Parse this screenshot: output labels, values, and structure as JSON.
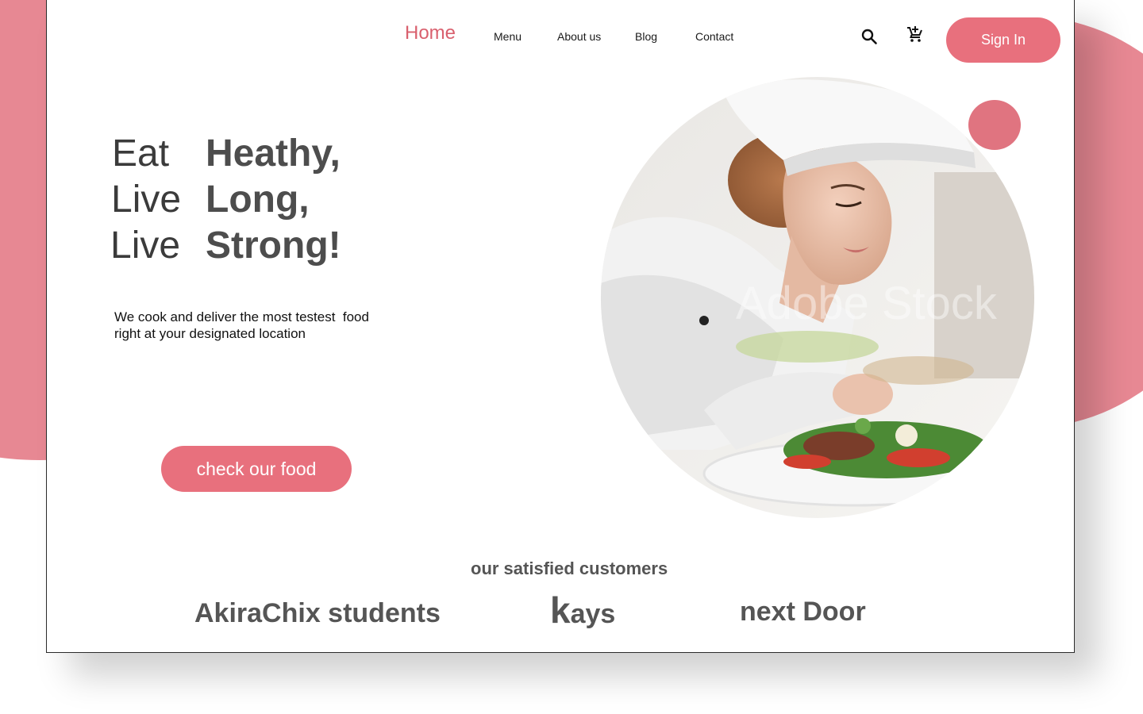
{
  "nav": {
    "home": "Home",
    "menu": "Menu",
    "about": "About us",
    "blog": "Blog",
    "contact": "Contact",
    "sign_in": "Sign In"
  },
  "icons": {
    "search": "search-icon",
    "cart": "add-shopping-cart-icon"
  },
  "hero": {
    "lines": [
      {
        "verb": "Eat",
        "word": "Heathy,"
      },
      {
        "verb": "Live",
        "word": "Long,"
      },
      {
        "verb": "Live",
        "word": "Strong!"
      }
    ],
    "description_line1": "We cook and deliver the most testest  food",
    "description_line2": "right at your designated location",
    "cta": "check our food",
    "image_watermark": "Adobe Stock"
  },
  "customers": {
    "heading": "our satisfied customers",
    "names": [
      {
        "first": "",
        "rest": "AkiraChix students"
      },
      {
        "first": "k",
        "rest": "ays"
      },
      {
        "first": "",
        "rest": "next Door"
      }
    ]
  },
  "colors": {
    "accent": "#e8707d",
    "blob": "#e78893",
    "home_active": "#d9606e",
    "text_dark": "#3b3b3b",
    "text_gray": "#555555"
  }
}
